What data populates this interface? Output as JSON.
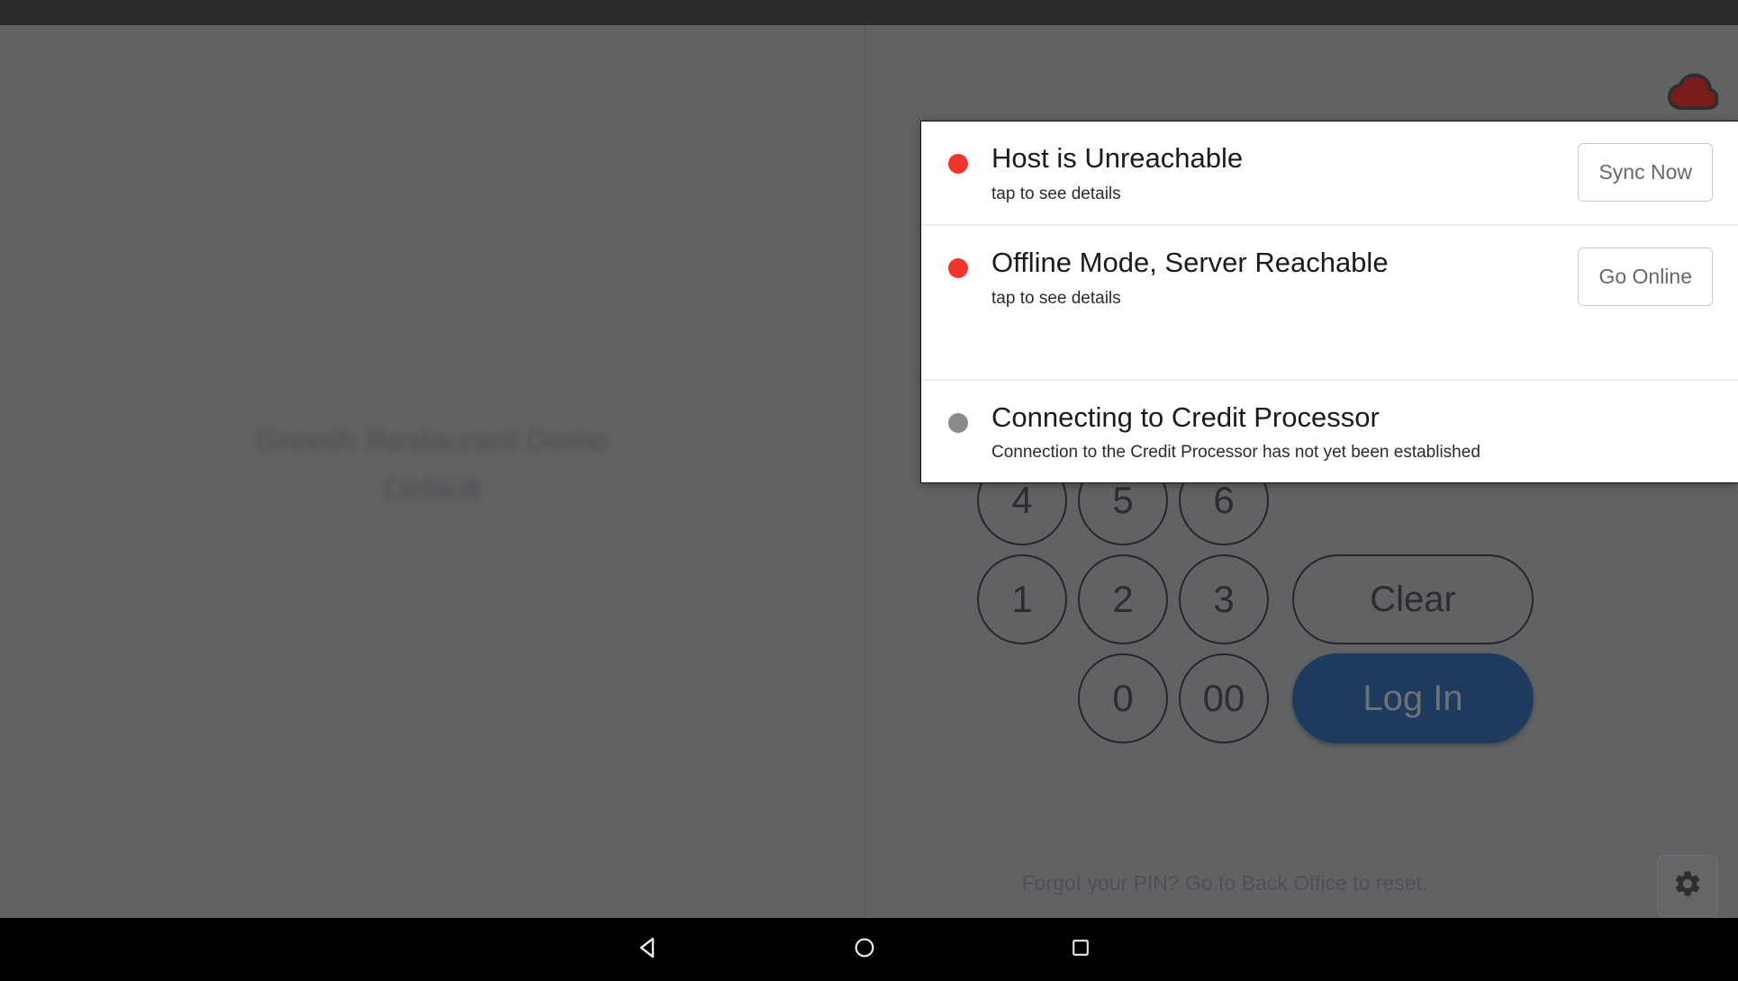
{
  "status_bar": {
    "background": "#2b2b2c"
  },
  "app": {
    "venue_name": "Greesh Restaurant Demo",
    "venue_profile": "Default",
    "cloud_status_icon": "cloud-icon",
    "cloud_color": "#7a1c1c"
  },
  "keypad": {
    "rows": [
      {
        "keys": [
          "4",
          "5",
          "6"
        ],
        "wide": null,
        "wide_type": null
      },
      {
        "keys": [
          "1",
          "2",
          "3"
        ],
        "wide": "Clear",
        "wide_type": "outline"
      },
      {
        "keys": [
          "",
          "0",
          "00"
        ],
        "wide": "Log In",
        "wide_type": "primary"
      }
    ],
    "login_color": "#1e3a5f"
  },
  "footer": {
    "hint": "Forgot your PIN? Go to Back Office to reset.",
    "settings_icon": "gear-icon"
  },
  "status_panel": {
    "notifications": [
      {
        "title": "Host is Unreachable",
        "subtitle": "tap to see details",
        "dot_color": "#f0352c",
        "action_label": "Sync Now",
        "tall": false
      },
      {
        "title": "Offline Mode, Server Reachable",
        "subtitle": "tap to see details",
        "dot_color": "#f0352c",
        "action_label": "Go Online",
        "tall": true
      },
      {
        "title": "Connecting to Credit Processor",
        "subtitle": "Connection to the Credit Processor has not yet been established",
        "dot_color": "#8a8a8a",
        "action_label": null,
        "tall": false
      }
    ]
  },
  "nav_bar": {
    "back_icon": "triangle-back-icon",
    "home_icon": "circle-home-icon",
    "recents_icon": "square-recents-icon"
  }
}
